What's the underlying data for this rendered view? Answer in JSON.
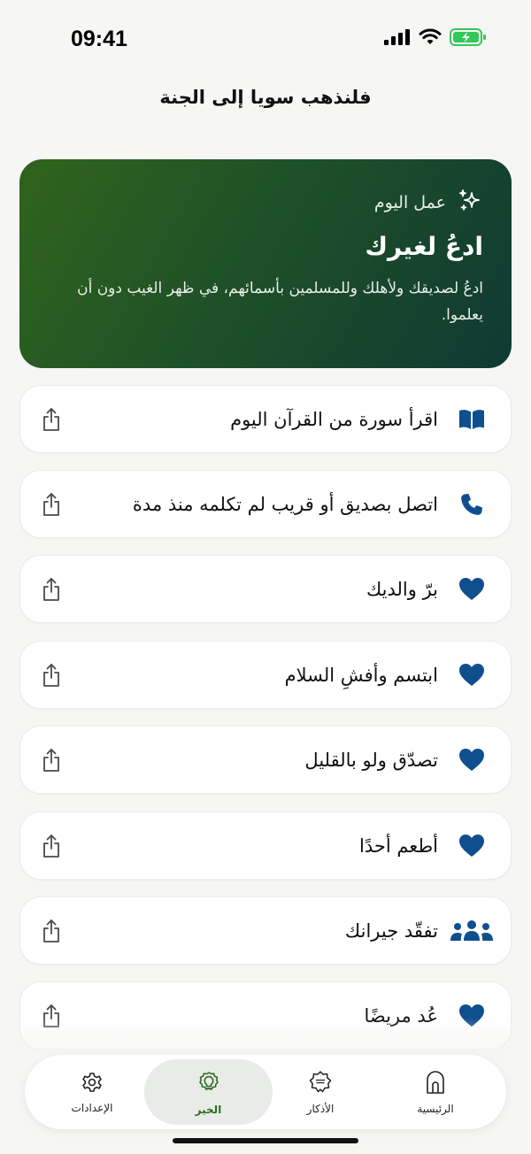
{
  "status_bar": {
    "time": "09:41"
  },
  "header": {
    "title": "فلنذهب سويا إلى الجنة"
  },
  "featured": {
    "kicker": "عمل اليوم",
    "title": "ادعُ لغيرك",
    "description": "ادعُ لصديقك ولأهلك وللمسلمين بأسمائهم، في ظهر الغيب دون أن يعلموا.",
    "icon": "sparkles-icon"
  },
  "deeds": [
    {
      "label": "اقرأ سورة من القرآن اليوم",
      "icon": "book-icon"
    },
    {
      "label": "اتصل بصديق أو قريب لم تكلمه منذ مدة",
      "icon": "phone-icon"
    },
    {
      "label": "برّ والديك",
      "icon": "heart-icon"
    },
    {
      "label": "ابتسم وأفشِ السلام",
      "icon": "heart-icon"
    },
    {
      "label": "تصدّق ولو بالقليل",
      "icon": "heart-icon"
    },
    {
      "label": "أطعم أحدًا",
      "icon": "heart-icon"
    },
    {
      "label": "تفقّد جيرانك",
      "icon": "people-icon"
    },
    {
      "label": "عُد مريضًا",
      "icon": "heart-icon"
    }
  ],
  "tabs": [
    {
      "label": "الرئيسية",
      "icon": "home-icon"
    },
    {
      "label": "الأذكار",
      "icon": "dhikr-icon"
    },
    {
      "label": "الخير",
      "icon": "lightbulb-icon",
      "active": true
    },
    {
      "label": "الإعدادات",
      "icon": "gear-icon"
    }
  ],
  "colors": {
    "accent_blue": "#0f4f8f",
    "active_green": "#2e6b1e",
    "card_gradient_start": "#30641c",
    "card_gradient_end": "#0f3a33",
    "battery_green": "#34c759"
  }
}
